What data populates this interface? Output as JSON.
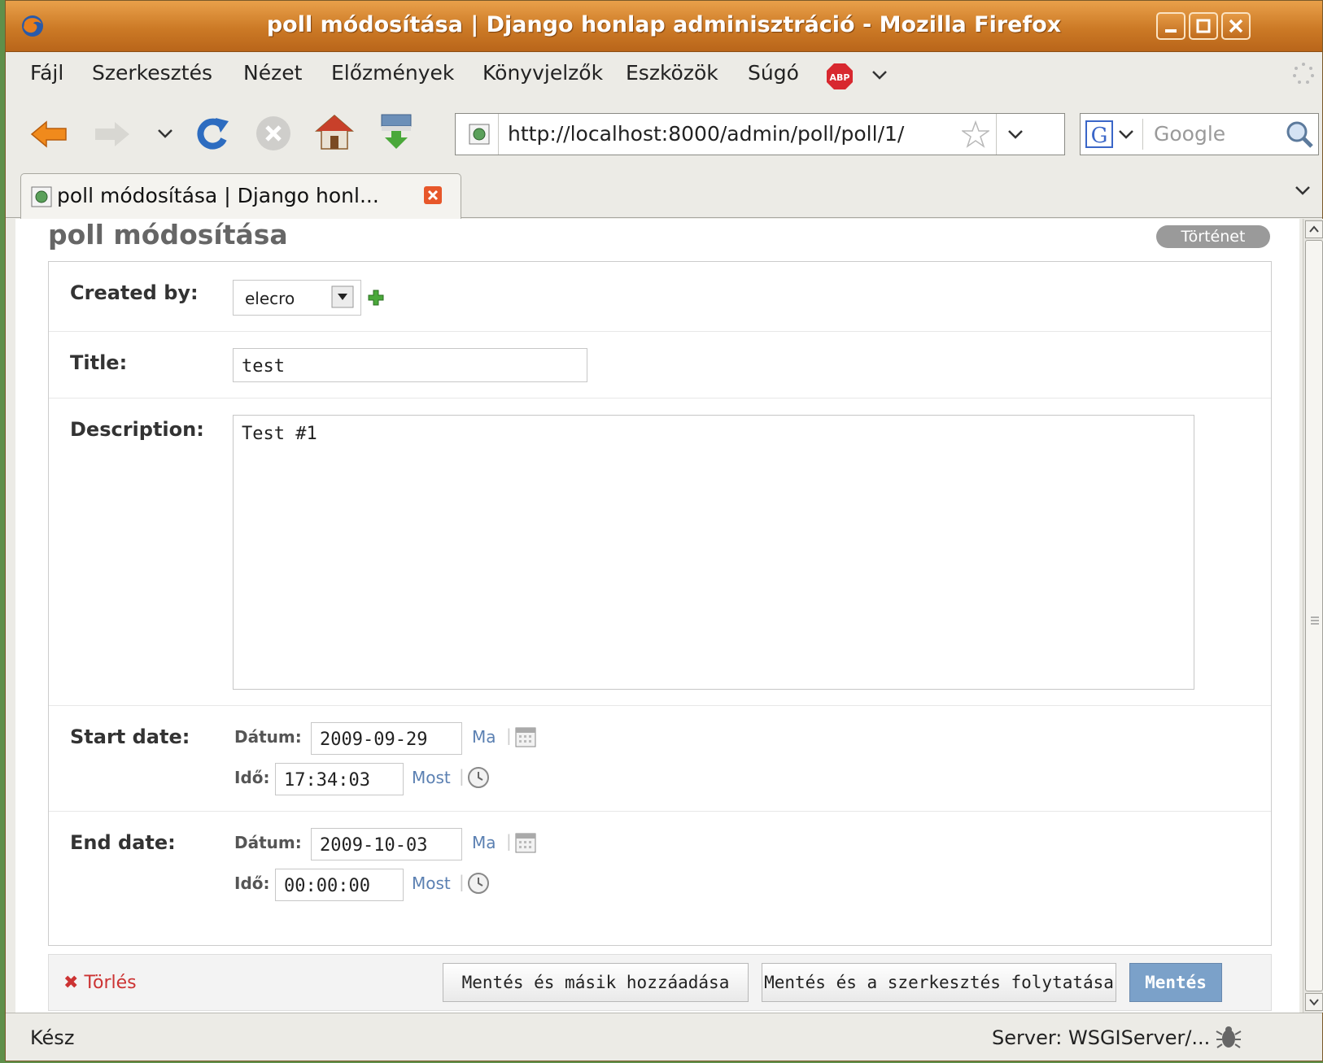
{
  "window": {
    "title": "poll módosítása | Django honlap adminisztráció - Mozilla Firefox"
  },
  "menu": {
    "items": [
      "Fájl",
      "Szerkesztés",
      "Nézet",
      "Előzmények",
      "Könyvjelzők",
      "Eszközök",
      "Súgó"
    ]
  },
  "navigation": {
    "url": "http://localhost:8000/admin/poll/poll/1/",
    "search_placeholder": "Google"
  },
  "tab": {
    "label": "poll módosítása | Django honl..."
  },
  "page": {
    "title": "poll módosítása",
    "history_button": "Történet"
  },
  "form": {
    "created_by": {
      "label": "Created by:",
      "value": "elecro"
    },
    "title": {
      "label": "Title:",
      "value": "test"
    },
    "description": {
      "label": "Description:",
      "value": "Test #1"
    },
    "start_date": {
      "label": "Start date:",
      "date_label": "Dátum:",
      "date_value": "2009-09-29",
      "date_shortcut": "Ma",
      "time_label": "Idő:",
      "time_value": "17:34:03",
      "time_shortcut": "Most"
    },
    "end_date": {
      "label": "End date:",
      "date_label": "Dátum:",
      "date_value": "2009-10-03",
      "date_shortcut": "Ma",
      "time_label": "Idő:",
      "time_value": "00:00:00",
      "time_shortcut": "Most"
    }
  },
  "actions": {
    "delete": "Törlés",
    "save_add_another": "Mentés és másik hozzáadása",
    "save_continue": "Mentés és a szerkesztés folytatása",
    "save": "Mentés"
  },
  "statusbar": {
    "status": "Kész",
    "server": "Server: WSGIServer/..."
  },
  "colors": {
    "titlebar": "#cc7a26",
    "link": "#5b80b2",
    "delete": "#cc3333",
    "primary_button": "#7ba1c9"
  }
}
